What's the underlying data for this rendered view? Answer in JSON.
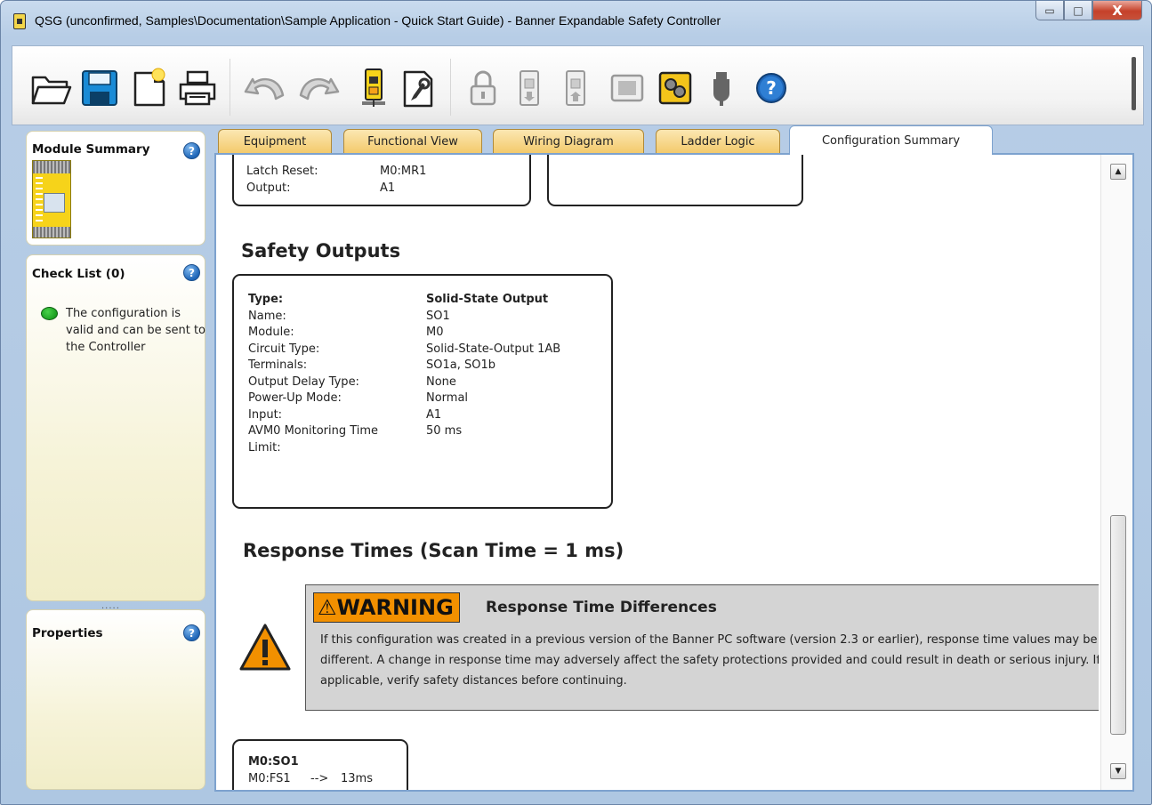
{
  "window": {
    "title": "QSG (unconfirmed, Samples\\Documentation\\Sample Application - Quick Start Guide) - Banner Expandable Safety Controller",
    "controls": {
      "minimize": "▭",
      "maximize": "□",
      "close": "X"
    }
  },
  "toolbar": {
    "items": [
      {
        "icon": "open-folder-icon"
      },
      {
        "icon": "save-icon"
      },
      {
        "icon": "new-document-icon"
      },
      {
        "icon": "print-icon"
      },
      {
        "icon": "undo-icon"
      },
      {
        "icon": "redo-icon"
      },
      {
        "icon": "controller-icon"
      },
      {
        "icon": "document-settings-icon"
      },
      {
        "icon": "lock-icon"
      },
      {
        "icon": "read-controller-icon"
      },
      {
        "icon": "write-controller-icon"
      },
      {
        "icon": "module-icon"
      },
      {
        "icon": "live-mode-icon"
      },
      {
        "icon": "usb-plug-icon"
      },
      {
        "icon": "help-icon"
      }
    ],
    "accent": "#f3c969"
  },
  "left": {
    "module_summary": {
      "title": "Module Summary",
      "help": "?"
    },
    "check_list": {
      "title": "Check List (0)",
      "help": "?",
      "status_text": "The configuration is valid and can be sent to the Controller",
      "status_color": "#189c1e"
    },
    "splitter": ".....",
    "properties": {
      "title": "Properties",
      "help": "?"
    }
  },
  "tabs": [
    {
      "label": "Equipment",
      "active": false
    },
    {
      "label": "Functional View",
      "active": false
    },
    {
      "label": "Wiring Diagram",
      "active": false
    },
    {
      "label": "Ladder Logic",
      "active": false
    },
    {
      "label": "Configuration Summary",
      "active": true
    }
  ],
  "content": {
    "top_box": {
      "rows": [
        {
          "key": "Latch Reset:",
          "value": "M0:MR1"
        },
        {
          "key": "Output:",
          "value": "A1"
        }
      ]
    },
    "safety_outputs": {
      "heading": "Safety Outputs",
      "header_row": {
        "key": "Type:",
        "value": "Solid-State Output"
      },
      "rows": [
        {
          "key": "Name:",
          "value": "SO1"
        },
        {
          "key": "Module:",
          "value": "M0"
        },
        {
          "key": "Circuit Type:",
          "value": "Solid-State-Output 1AB"
        },
        {
          "key": "Terminals:",
          "value": "SO1a, SO1b"
        },
        {
          "key": "Output Delay Type:",
          "value": "None"
        },
        {
          "key": "Power-Up Mode:",
          "value": "Normal"
        },
        {
          "key": "Input:",
          "value": "A1"
        },
        {
          "key": "AVM0 Monitoring Time",
          "value": "50 ms"
        },
        {
          "key": "Limit:",
          "value": ""
        }
      ]
    },
    "response_times": {
      "heading": "Response Times (Scan Time = 1 ms)",
      "warning": {
        "tag": "WARNING",
        "tag_symbol": "⚠",
        "title": "Response Time Differences",
        "body": "If this configuration was created in a previous version of the Banner PC software (version 2.3 or earlier), response time values may be different. A change in response time may adversely affect the safety protections provided and could result in death or serious injury. If applicable, verify safety distances before continuing.",
        "tag_color": "#f29000"
      },
      "result_box": {
        "title": "M0:SO1",
        "row_key": "M0:FS1",
        "row_arrow": "-->",
        "row_value": "13ms"
      }
    },
    "scrollbar": {
      "up": "▲",
      "down": "▼"
    }
  }
}
